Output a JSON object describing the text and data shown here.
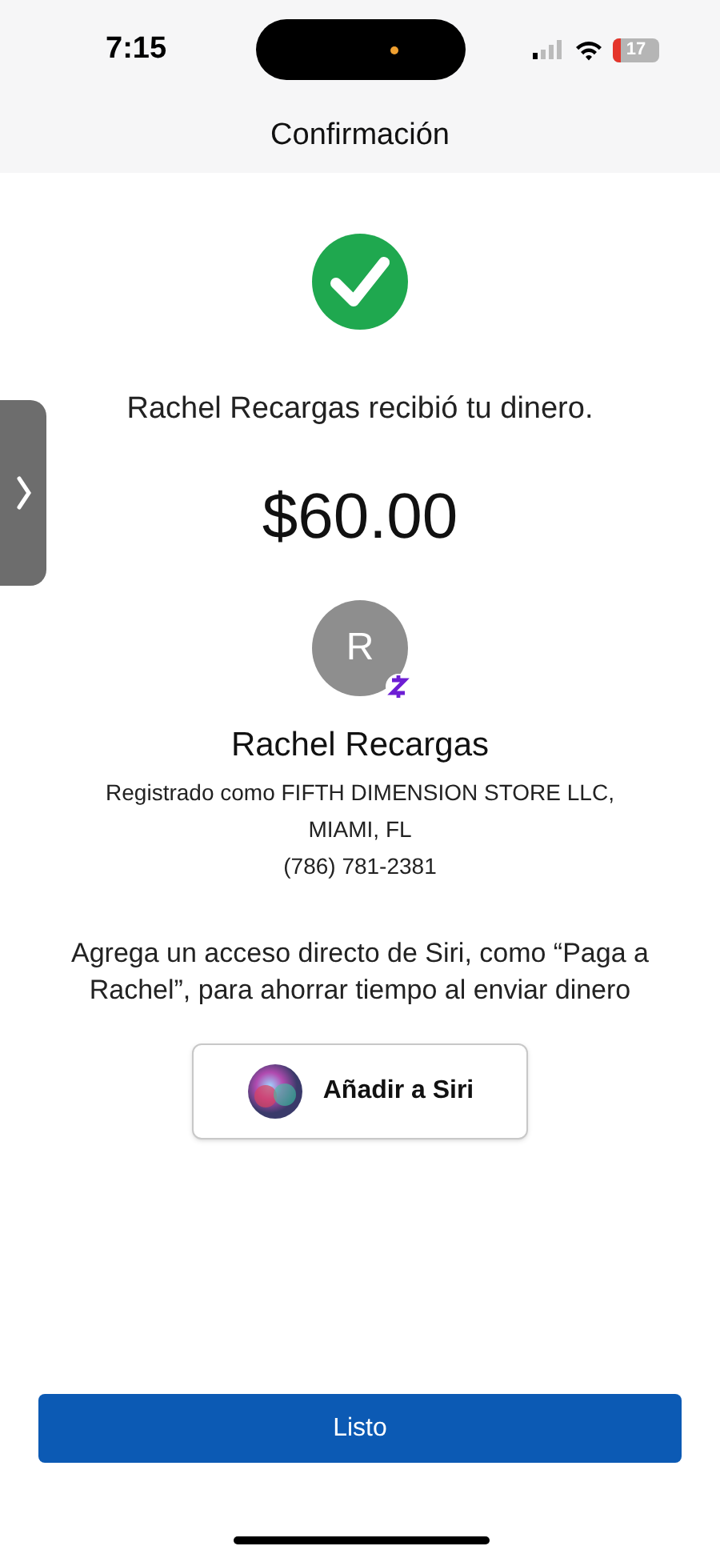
{
  "status_bar": {
    "time": "7:15",
    "battery": "17"
  },
  "header": {
    "title": "Confirmación"
  },
  "message": "Rachel Recargas recibió tu dinero.",
  "amount": "$60.00",
  "recipient": {
    "initial": "R",
    "name": "Rachel Recargas",
    "registered": "Registrado como FIFTH DIMENSION STORE LLC,",
    "location": "MIAMI, FL",
    "phone": "(786) 781-2381"
  },
  "siri_hint": "Agrega un acceso directo de Siri, como “Paga a Rachel”, para ahorrar tiempo al enviar dinero",
  "siri_button": "Añadir a Siri",
  "done_button": "Listo"
}
